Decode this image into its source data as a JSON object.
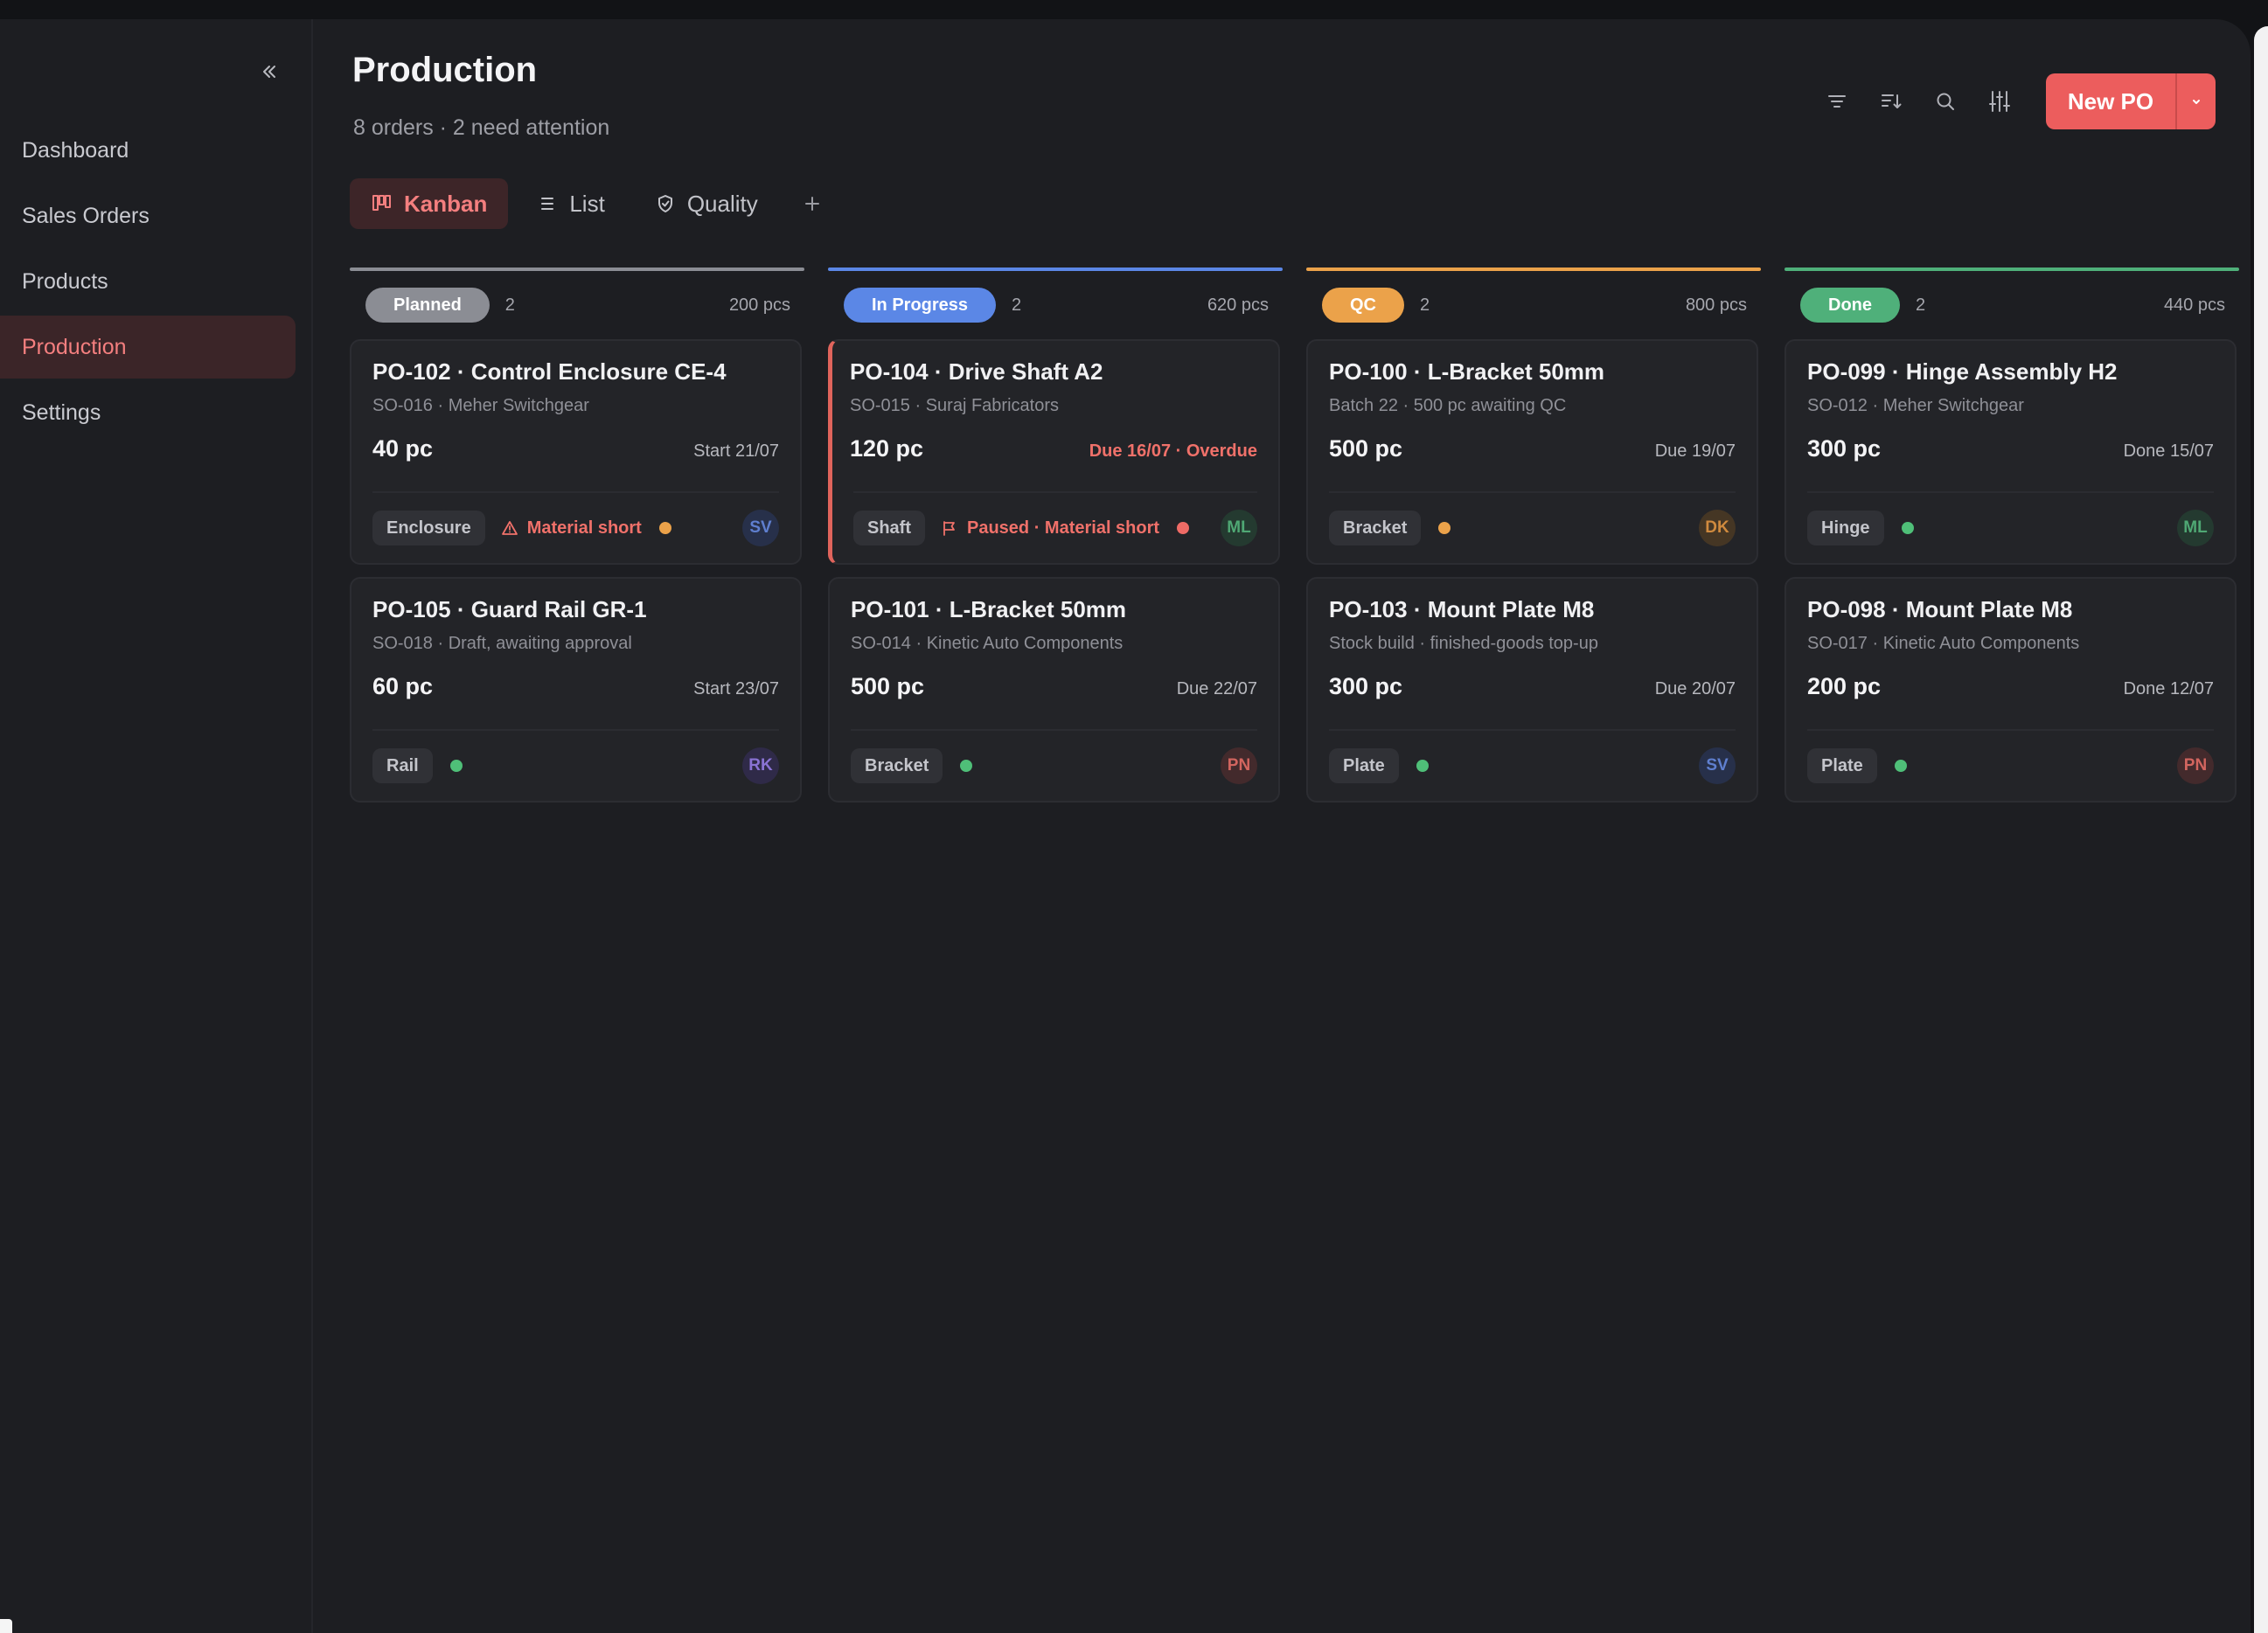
{
  "sidebar": {
    "items": [
      {
        "label": "Dashboard"
      },
      {
        "label": "Sales Orders"
      },
      {
        "label": "Products"
      },
      {
        "label": "Production",
        "active": true
      },
      {
        "label": "Settings"
      }
    ],
    "collapse_icon": "chevrons-left-icon"
  },
  "header": {
    "title": "Production",
    "subtitle": "8 orders · 2 need attention",
    "new_button": "New PO",
    "toolbar_icons": [
      "filter-icon",
      "sort-icon",
      "search-icon",
      "sliders-icon"
    ]
  },
  "tabs": [
    {
      "label": "Kanban",
      "icon": "kanban-icon",
      "active": true
    },
    {
      "label": "List",
      "icon": "list-icon"
    },
    {
      "label": "Quality",
      "icon": "shield-check-icon"
    }
  ],
  "colors": {
    "accent": "#ec5d5d",
    "planned": "#8b8d94",
    "in_progress": "#5b87e6",
    "qc": "#eba24a",
    "done": "#4fb07a",
    "dot_warn": "#eba24a",
    "dot_ok": "#4fbf78",
    "dot_alert": "#ef6b66"
  },
  "columns": [
    {
      "status": "Planned",
      "count": "2",
      "total": "200 pcs",
      "cards": [
        {
          "title": "PO-102 · Control Enclosure CE-4",
          "sub": "SO-016 · Meher Switchgear",
          "qty": "40 pc",
          "date": "Start 21/07",
          "chip": "Enclosure",
          "warn": "Material short",
          "avatar": "SV"
        },
        {
          "title": "PO-105 · Guard Rail GR-1",
          "sub": "SO-018 · Draft, awaiting approval",
          "qty": "60 pc",
          "date": "Start 23/07",
          "chip": "Rail",
          "avatar": "RK"
        }
      ]
    },
    {
      "status": "In Progress",
      "count": "2",
      "total": "620 pcs",
      "cards": [
        {
          "title": "PO-104 · Drive Shaft A2",
          "sub": "SO-015 · Suraj Fabricators",
          "qty": "120 pc",
          "date": "Due 16/07 · Overdue",
          "chip": "Shaft",
          "warn": "Paused · Material short",
          "avatar": "ML"
        },
        {
          "title": "PO-101 · L-Bracket 50mm",
          "sub": "SO-014 · Kinetic Auto Components",
          "qty": "500 pc",
          "date": "Due 22/07",
          "chip": "Bracket",
          "avatar": "PN"
        }
      ]
    },
    {
      "status": "QC",
      "count": "2",
      "total": "800 pcs",
      "cards": [
        {
          "title": "PO-100 · L-Bracket 50mm",
          "sub": "Batch 22 · 500 pc awaiting QC",
          "qty": "500 pc",
          "date": "Due 19/07",
          "chip": "Bracket",
          "avatar": "DK"
        },
        {
          "title": "PO-103 · Mount Plate M8",
          "sub": "Stock build · finished-goods top-up",
          "qty": "300 pc",
          "date": "Due 20/07",
          "chip": "Plate",
          "avatar": "SV"
        }
      ]
    },
    {
      "status": "Done",
      "count": "2",
      "total": "440 pcs",
      "cards": [
        {
          "title": "PO-099 · Hinge Assembly H2",
          "sub": "SO-012 · Meher Switchgear",
          "qty": "300 pc",
          "date": "Done 15/07",
          "chip": "Hinge",
          "avatar": "ML"
        },
        {
          "title": "PO-098 · Mount Plate M8",
          "sub": "SO-017 · Kinetic Auto Components",
          "qty": "200 pc",
          "date": "Done 12/07",
          "chip": "Plate",
          "avatar": "PN"
        }
      ]
    }
  ]
}
